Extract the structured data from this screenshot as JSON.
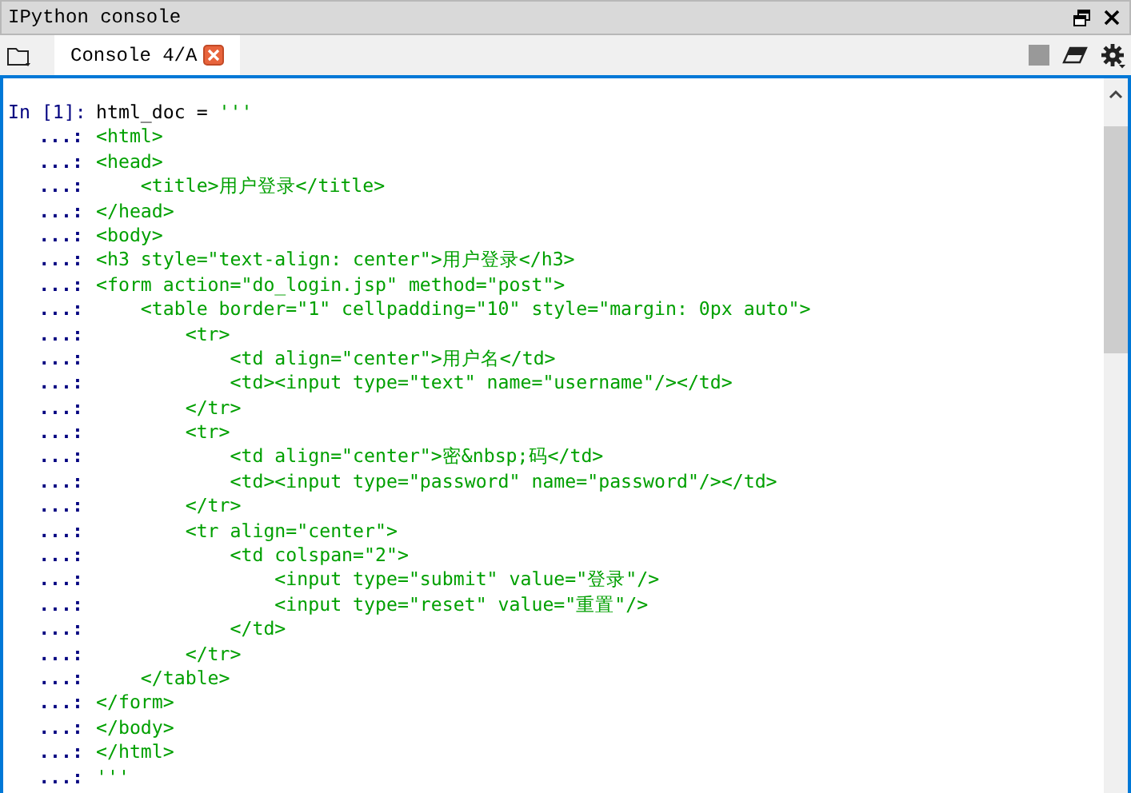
{
  "pane": {
    "title": "IPython console"
  },
  "tabs": [
    {
      "label": "Console 4/A",
      "selected": true
    }
  ],
  "console": {
    "lines": [
      {
        "kind": "input",
        "prompt": "In [1]:",
        "code": "html_doc = ",
        "string": "'''"
      },
      {
        "kind": "continuation",
        "prompt": "...:",
        "code": "<html>"
      },
      {
        "kind": "continuation",
        "prompt": "...:",
        "code": "<head>"
      },
      {
        "kind": "continuation",
        "prompt": "...:",
        "code": "    <title>用户登录</title>"
      },
      {
        "kind": "continuation",
        "prompt": "...:",
        "code": "</head>"
      },
      {
        "kind": "continuation",
        "prompt": "...:",
        "code": "<body>"
      },
      {
        "kind": "continuation",
        "prompt": "...:",
        "code": "<h3 style=\"text-align: center\">用户登录</h3>"
      },
      {
        "kind": "continuation",
        "prompt": "...:",
        "code": "<form action=\"do_login.jsp\" method=\"post\">"
      },
      {
        "kind": "continuation",
        "prompt": "...:",
        "code": "    <table border=\"1\" cellpadding=\"10\" style=\"margin: 0px auto\">"
      },
      {
        "kind": "continuation",
        "prompt": "...:",
        "code": "        <tr>"
      },
      {
        "kind": "continuation",
        "prompt": "...:",
        "code": "            <td align=\"center\">用户名</td>"
      },
      {
        "kind": "continuation",
        "prompt": "...:",
        "code": "            <td><input type=\"text\" name=\"username\"/></td>"
      },
      {
        "kind": "continuation",
        "prompt": "...:",
        "code": "        </tr>"
      },
      {
        "kind": "continuation",
        "prompt": "...:",
        "code": "        <tr>"
      },
      {
        "kind": "continuation",
        "prompt": "...:",
        "code": "            <td align=\"center\">密&nbsp;码</td>"
      },
      {
        "kind": "continuation",
        "prompt": "...:",
        "code": "            <td><input type=\"password\" name=\"password\"/></td>"
      },
      {
        "kind": "continuation",
        "prompt": "...:",
        "code": "        </tr>"
      },
      {
        "kind": "continuation",
        "prompt": "...:",
        "code": "        <tr align=\"center\">"
      },
      {
        "kind": "continuation",
        "prompt": "...:",
        "code": "            <td colspan=\"2\">"
      },
      {
        "kind": "continuation",
        "prompt": "...:",
        "code": "                <input type=\"submit\" value=\"登录\"/>"
      },
      {
        "kind": "continuation",
        "prompt": "...:",
        "code": "                <input type=\"reset\" value=\"重置\"/>"
      },
      {
        "kind": "continuation",
        "prompt": "...:",
        "code": "            </td>"
      },
      {
        "kind": "continuation",
        "prompt": "...:",
        "code": "        </tr>"
      },
      {
        "kind": "continuation",
        "prompt": "...:",
        "code": "    </table>"
      },
      {
        "kind": "continuation",
        "prompt": "...:",
        "code": "</form>"
      },
      {
        "kind": "continuation",
        "prompt": "...:",
        "code": "</body>"
      },
      {
        "kind": "continuation",
        "prompt": "...:",
        "code": "</html>"
      },
      {
        "kind": "continuation",
        "prompt": "...:",
        "code": "'''"
      }
    ]
  }
}
